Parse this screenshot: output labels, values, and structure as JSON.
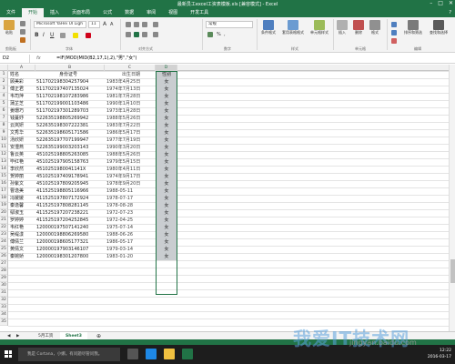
{
  "window": {
    "title": "最新员工excel工资表模板.xls [兼容模式] - Excel"
  },
  "menu": {
    "items": [
      "文件",
      "开始",
      "插入",
      "页面布局",
      "公式",
      "数据",
      "审阅",
      "视图",
      "开发工具"
    ],
    "active_index": 1,
    "help": "?"
  },
  "ribbon": {
    "font_name": "Microsoft YaHei UI Ligh",
    "font_size": "11",
    "number_format": "常规",
    "paste": "粘贴",
    "groups": {
      "clipboard": "剪贴板",
      "font": "字体",
      "alignment": "对齐方式",
      "number": "数字",
      "styles": "样式",
      "cells": "单元格",
      "editing": "编辑"
    },
    "buttons": {
      "cond_format": "条件格式",
      "table_format": "套用表格格式",
      "cell_styles": "单元格样式",
      "insert": "插入",
      "delete": "删除",
      "format": "格式",
      "sort_filter": "排序和筛选",
      "find_select": "查找和选择"
    }
  },
  "formula_bar": {
    "name_box": "D2",
    "fx": "fx",
    "formula": "=IF(MOD(MID(B2,17,1),2),\"男\",\"女\")"
  },
  "columns": [
    "A",
    "B",
    "C",
    "D"
  ],
  "table": {
    "headers": [
      "姓名",
      "身份证号",
      "出生日期",
      "性别"
    ],
    "rows": [
      [
        "顾美彩",
        "511702198304257904",
        "1983年4月25日",
        "女"
      ],
      [
        "傅正君",
        "511702197407135024",
        "1974年7月13日",
        "女"
      ],
      [
        "韦司萍",
        "511702198107283986",
        "1981年7月28日",
        "女"
      ],
      [
        "蒲芷芝",
        "511702199001103486",
        "1990年1月10日",
        "女"
      ],
      [
        "姜珊巧",
        "511702197301289703",
        "1973年1月28日",
        "女"
      ],
      [
        "钱蔓妤",
        "522635198805269942",
        "1988年5月26日",
        "女"
      ],
      [
        "云岚妍",
        "522635198307222381",
        "1983年7月22日",
        "女"
      ],
      [
        "文秀华",
        "522635198605171586",
        "1986年5月17日",
        "女"
      ],
      [
        "汤欣妍",
        "522635197707199947",
        "1977年7月19日",
        "女"
      ],
      [
        "安澧燕",
        "522635199003203143",
        "1990年3月20日",
        "女"
      ],
      [
        "鲁云英",
        "451025198805263085",
        "1988年5月26日",
        "女"
      ],
      [
        "毕红艳",
        "451025197905158763",
        "1979年5月15日",
        "女"
      ],
      [
        "李欣然",
        "451025198004114​1X",
        "1980年4月11日",
        "女"
      ],
      [
        "贺婷丽",
        "451025197409178941",
        "1974年9月17日",
        "女"
      ],
      [
        "孙紫文",
        "451025197809205945",
        "1978年9月20日",
        "女"
      ],
      [
        "曹逸美",
        "411525198805116966",
        "1988-05-11",
        "女"
      ],
      [
        "冯媛媛",
        "411525197807172924",
        "1978-07-17",
        "女"
      ],
      [
        "秦逸馨",
        "411525197808281145",
        "1978-08-28",
        "女"
      ],
      [
        "鄢淑玉",
        "411525197207238221",
        "1972-07-23",
        "女"
      ],
      [
        "罗婷婷",
        "411525197204252845",
        "1972-04-25",
        "女"
      ],
      [
        "韦红艳",
        "120000197507141240",
        "1975-07-14",
        "女"
      ],
      [
        "吴缇漾",
        "120000198806269580",
        "1988-06-26",
        "女"
      ],
      [
        "傅倩兰",
        "120000198605177321",
        "1986-05-17",
        "女"
      ],
      [
        "黄倩文",
        "120000197903146107",
        "1979-03-14",
        "女"
      ],
      [
        "秦婉娇",
        "120000198301207800",
        "1983-01-20",
        "女"
      ]
    ]
  },
  "sheets": {
    "tabs": [
      "5月工资",
      "Sheet3"
    ],
    "active_index": 1
  },
  "taskbar": {
    "search_placeholder": "我是 Cortana，小娜。有问题尽管问我。",
    "time": "12:22",
    "date": "2016-03-17"
  },
  "watermark": {
    "line1": "我爱IT技术网",
    "line2": "jingyan.baidu.com"
  },
  "colors": {
    "excel_green": "#217346",
    "selected_fill": "#c9cdd0"
  }
}
